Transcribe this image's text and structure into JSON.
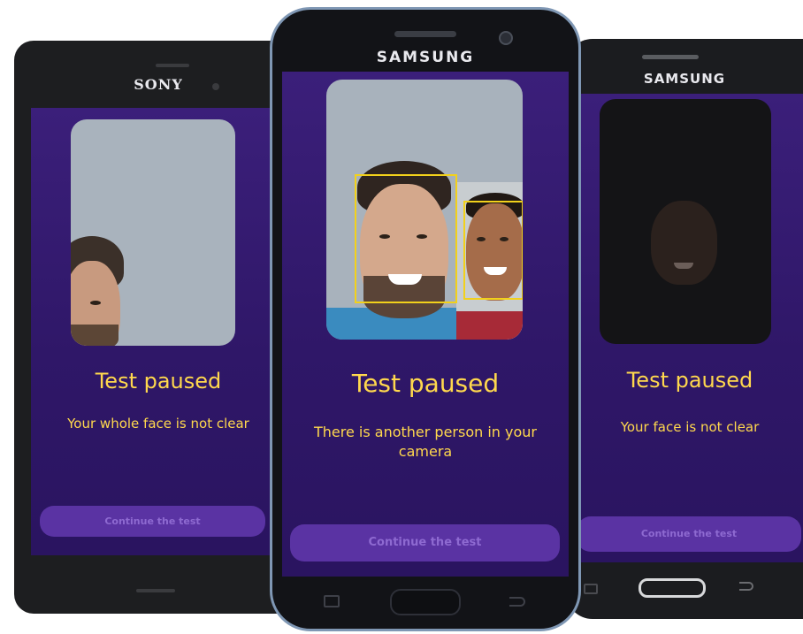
{
  "phones": {
    "left": {
      "brand": "SONY",
      "title": "Test paused",
      "message": "Your whole face is not clear",
      "button": "Continue the test"
    },
    "center": {
      "brand": "SAMSUNG",
      "title": "Test paused",
      "message": "There is another person in your camera",
      "button": "Continue the test"
    },
    "right": {
      "brand": "SAMSUNG",
      "title": "Test paused",
      "message": "Your face is not clear",
      "button": "Continue the test"
    }
  },
  "colors": {
    "background": "#2f1768",
    "text_accent": "#ffd84d",
    "button": "#5a33a3",
    "focus_box": "#f2d11b"
  },
  "icons": [
    "camera-icon",
    "home-button-icon",
    "back-icon",
    "recent-apps-icon"
  ]
}
